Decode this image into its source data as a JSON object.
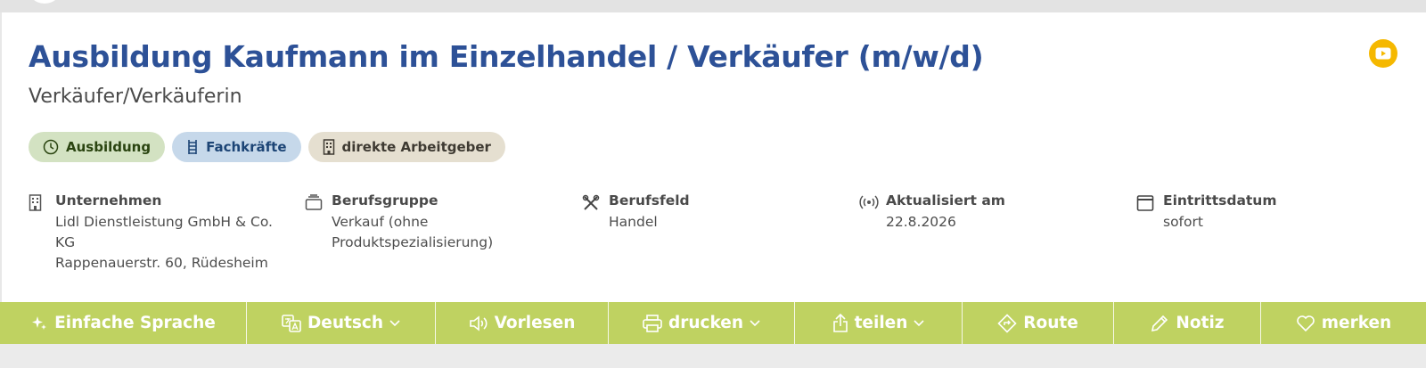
{
  "job": {
    "title": "Ausbildung Kaufmann im Einzelhandel / Verkäufer (m/w/d)",
    "subtitle": "Verkäufer/Verkäuferin"
  },
  "tags": [
    {
      "label": "Ausbildung",
      "icon": "clock-icon"
    },
    {
      "label": "Fachkräfte",
      "icon": "ladder-icon"
    },
    {
      "label": "direkte Arbeitgeber",
      "icon": "building-icon"
    }
  ],
  "details": {
    "company": {
      "label": "Unternehmen",
      "value1": "Lidl Dienstleistung GmbH & Co. KG",
      "value2": "Rappenauerstr. 60, Rüdesheim",
      "icon": "building-icon"
    },
    "group": {
      "label": "Berufsgruppe",
      "value1": "Verkauf (ohne Produktspezialisierung)",
      "icon": "briefcase-icon"
    },
    "field": {
      "label": "Berufsfeld",
      "value1": "Handel",
      "icon": "tools-icon"
    },
    "updated": {
      "label": "Aktualisiert am",
      "value1": "22.8.2026",
      "icon": "broadcast-icon"
    },
    "start": {
      "label": "Eintrittsdatum",
      "value1": "sofort",
      "icon": "calendar-icon"
    }
  },
  "toolbar": {
    "simple": "Einfache Sprache",
    "language": "Deutsch",
    "read": "Vorlesen",
    "print": "drucken",
    "share": "teilen",
    "route": "Route",
    "note": "Notiz",
    "save": "merken"
  },
  "colors": {
    "title": "#2d5197",
    "toolbar": "#bfd261",
    "video": "#f5b800"
  }
}
